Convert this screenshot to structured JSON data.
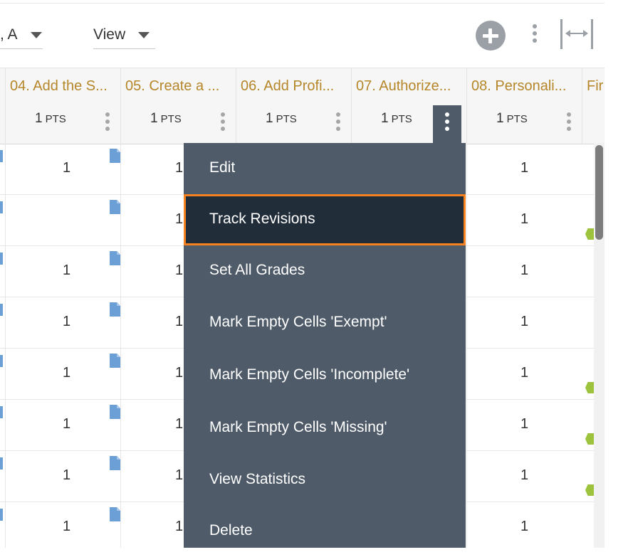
{
  "toolbar": {
    "sort_label": ", A",
    "view_label": "View",
    "add_icon": "plus-circle-icon",
    "more_icon": "vertical-ellipsis-icon",
    "collapse_icon": "collapse-columns-icon"
  },
  "columns": [
    {
      "title": "04. Add the S...",
      "pts_value": "1",
      "pts_unit": "PTS"
    },
    {
      "title": "05. Create a ...",
      "pts_value": "1",
      "pts_unit": "PTS"
    },
    {
      "title": "06. Add Profi...",
      "pts_value": "1",
      "pts_unit": "PTS"
    },
    {
      "title": "07. Authorize...",
      "pts_value": "1",
      "pts_unit": "PTS"
    },
    {
      "title": "08. Personali...",
      "pts_value": "1",
      "pts_unit": "PTS"
    },
    {
      "title": "Fir"
    }
  ],
  "rows": [
    {
      "c04": "1",
      "c05": "1",
      "c08": "1"
    },
    {
      "c04": "",
      "c05": "1",
      "c08": "1"
    },
    {
      "c04": "1",
      "c05": "1",
      "c08": "1"
    },
    {
      "c04": "1",
      "c05": "1",
      "c08": "1"
    },
    {
      "c04": "1",
      "c05": "1",
      "c08": "1"
    },
    {
      "c04": "1",
      "c05": "1",
      "c08": "1"
    },
    {
      "c04": "1",
      "c05": "1",
      "c08": "1"
    },
    {
      "c04": "1",
      "c05": "1",
      "c08": "1"
    }
  ],
  "menu": {
    "items": [
      {
        "label": "Edit"
      },
      {
        "label": "Track Revisions",
        "highlighted": true
      },
      {
        "label": "Set All Grades"
      },
      {
        "label": "Mark Empty Cells 'Exempt'"
      },
      {
        "label": "Mark Empty Cells 'Incomplete'"
      },
      {
        "label": "Mark Empty Cells 'Missing'"
      },
      {
        "label": "View Statistics"
      },
      {
        "label": "Delete"
      }
    ]
  },
  "colors": {
    "header_title": "#b5862a",
    "menu_bg": "#4f5b69",
    "menu_selected_bg": "#222d3a",
    "focus_outline": "#f5821f",
    "doc_icon": "#6c9fd6",
    "status_green": "#9cc33b"
  }
}
